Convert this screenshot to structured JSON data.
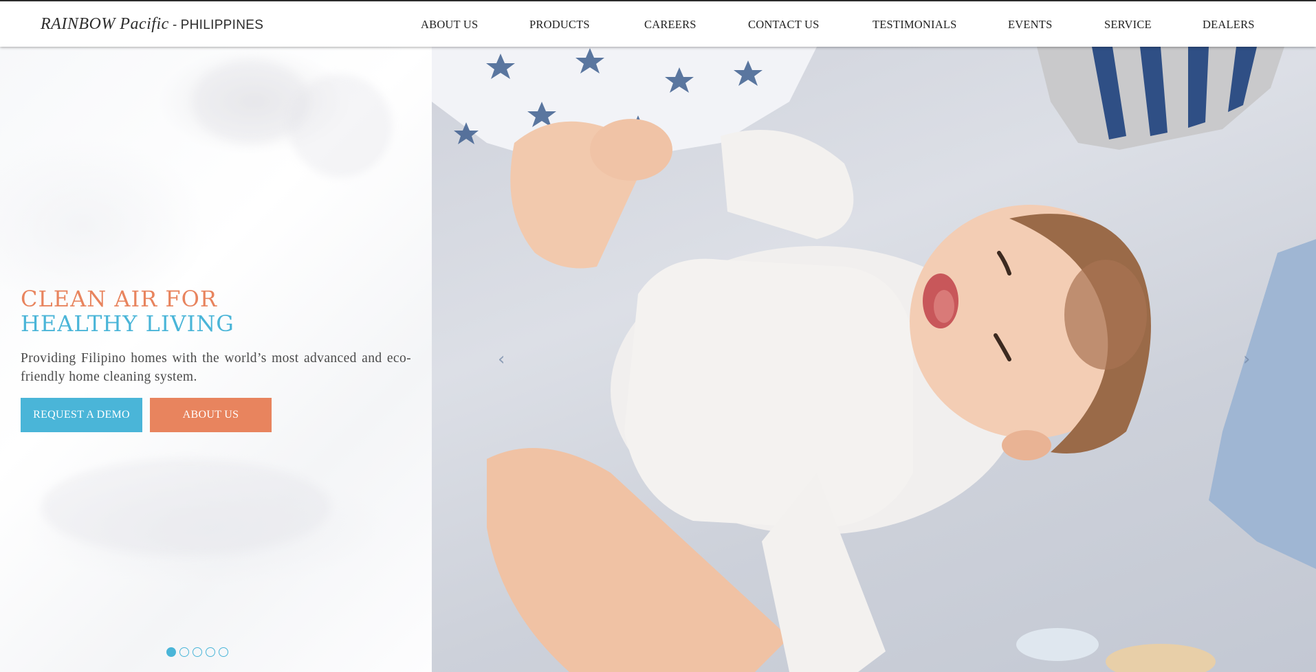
{
  "brand": {
    "name": "RAINBOW Pacific",
    "separator": " - ",
    "country": "PHILIPPINES"
  },
  "nav": {
    "items": [
      {
        "label": "ABOUT US"
      },
      {
        "label": "PRODUCTS"
      },
      {
        "label": "CAREERS"
      },
      {
        "label": "CONTACT US"
      },
      {
        "label": "TESTIMONIALS"
      },
      {
        "label": "EVENTS"
      },
      {
        "label": "SERVICE"
      },
      {
        "label": "DEALERS"
      }
    ]
  },
  "hero": {
    "headline_line1": "CLEAN AIR FOR",
    "headline_line2": "HEALTHY LIVING",
    "tagline": "Providing Filipino homes with the world’s most advanced and eco-friendly home cleaning system.",
    "cta_demo": "REQUEST A DEMO",
    "cta_about": "ABOUT US"
  },
  "carousel": {
    "slide_count": 5,
    "active_slide": 1,
    "prev_icon": "chevron-left-icon",
    "next_icon": "chevron-right-icon",
    "prev_glyph": "‹",
    "next_glyph": "›"
  },
  "colors": {
    "accent_orange": "#e8845e",
    "accent_blue": "#4ab5d8"
  }
}
